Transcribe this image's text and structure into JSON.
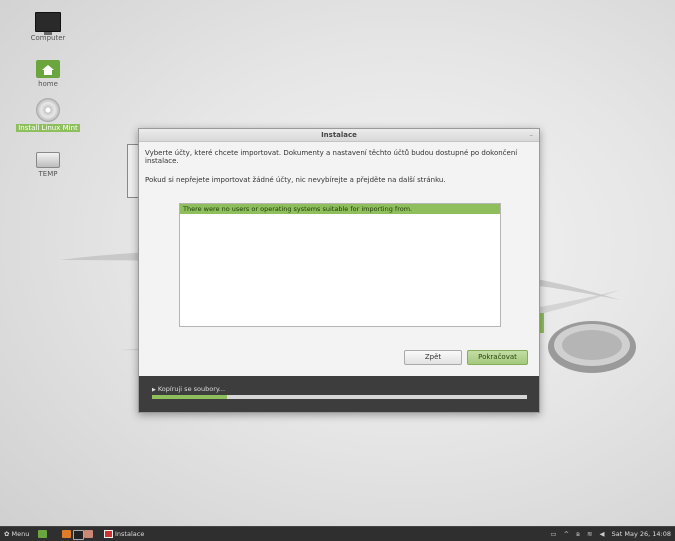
{
  "desktop": {
    "icons": [
      {
        "label": "Computer",
        "icon": "computer-icon"
      },
      {
        "label": "home",
        "icon": "home-folder-icon"
      },
      {
        "label": "Install Linux Mint",
        "icon": "disc-icon"
      },
      {
        "label": "TEMP",
        "icon": "drive-icon"
      }
    ],
    "accent_color": "#8fbf5d"
  },
  "window": {
    "title": "Instalace",
    "intro_text": "Vyberte účty, které chcete importovat. Dokumenty a nastavení těchto účtů budou dostupné po dokončení instalace.",
    "intro_text2": "Pokud si nepřejete importovat žádné účty, nic nevybírejte a přejděte na další stránku.",
    "list_message": "There were no users or operating systems suitable for importing from.",
    "buttons": {
      "back": "Zpět",
      "continue": "Pokračovat"
    },
    "progress": {
      "label": "Kopíruji se soubory...",
      "fraction": 0.2
    }
  },
  "taskbar": {
    "menu_label": "Menu",
    "task_label": "Instalace",
    "clock": "Sat May 26, 14:08"
  }
}
